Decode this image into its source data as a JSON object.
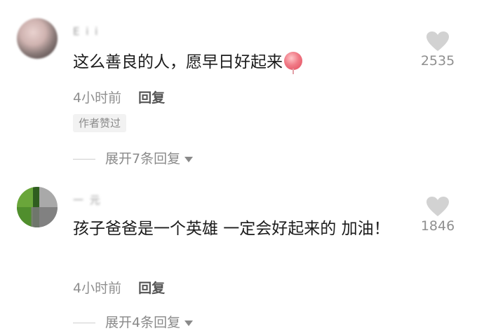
{
  "comments": [
    {
      "username": "E i i",
      "text": "这么善良的人，愿早日好起来",
      "emoji": "lollipop-icon",
      "time": "4小时前",
      "reply_label": "回复",
      "author_liked": "作者赞过",
      "expand_label": "展开7条回复",
      "like_count": "2535"
    },
    {
      "username": "一 元",
      "text": "孩子爸爸是一个英雄 一定会好起来的 加油！",
      "time": "4小时前",
      "reply_label": "回复",
      "expand_label": "展开4条回复",
      "like_count": "1846"
    }
  ],
  "colors": {
    "text": "#1b1b1b",
    "meta": "#8f8f8f",
    "like_icon": "#d2d2d2"
  }
}
